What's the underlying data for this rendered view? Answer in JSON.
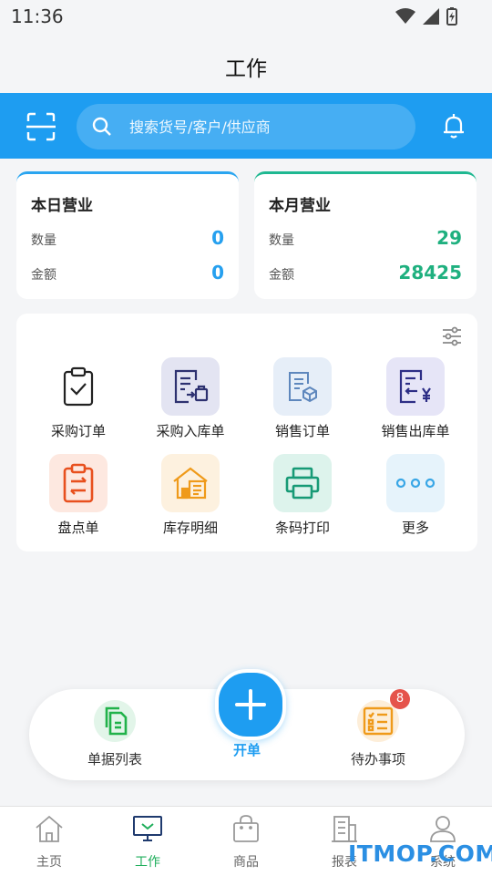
{
  "status_bar": {
    "time": "11:36"
  },
  "header": {
    "title": "工作"
  },
  "search": {
    "placeholder": "搜索货号/客户/供应商"
  },
  "stats": {
    "today": {
      "title": "本日营业",
      "qty_label": "数量",
      "qty_value": "0",
      "amount_label": "金额",
      "amount_value": "0"
    },
    "month": {
      "title": "本月营业",
      "qty_label": "数量",
      "qty_value": "29",
      "amount_label": "金额",
      "amount_value": "28425"
    }
  },
  "functions": [
    {
      "label": "采购订单",
      "icon": "clipboard-check-icon"
    },
    {
      "label": "采购入库单",
      "icon": "inbound-doc-icon"
    },
    {
      "label": "销售订单",
      "icon": "sales-doc-icon"
    },
    {
      "label": "销售出库单",
      "icon": "outbound-doc-icon"
    },
    {
      "label": "盘点单",
      "icon": "inventory-check-icon"
    },
    {
      "label": "库存明细",
      "icon": "warehouse-icon"
    },
    {
      "label": "条码打印",
      "icon": "printer-icon"
    },
    {
      "label": "更多",
      "icon": "more-icon"
    }
  ],
  "action_bar": {
    "doc_list_label": "单据列表",
    "create_label": "开单",
    "todo_label": "待办事项",
    "todo_badge": "8"
  },
  "tabs": [
    {
      "label": "主页",
      "icon": "home-icon"
    },
    {
      "label": "工作",
      "icon": "monitor-icon"
    },
    {
      "label": "商品",
      "icon": "bag-icon"
    },
    {
      "label": "报表",
      "icon": "building-icon"
    },
    {
      "label": "系统",
      "icon": "user-icon"
    }
  ],
  "watermark": "ITMOP.COM",
  "colors": {
    "primary": "#1e9df1",
    "accent_green": "#1fb07f",
    "badge_red": "#e5534b",
    "tab_active": "#1fae5b"
  }
}
